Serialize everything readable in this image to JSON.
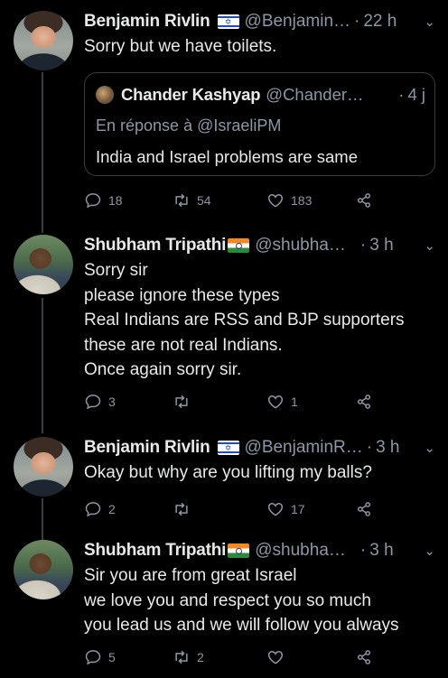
{
  "tweets": [
    {
      "author": "Benjamin Rivlin",
      "flag": "il",
      "handle": "@Benjamin…",
      "time": "22 h",
      "text": [
        "Sorry but we have toilets."
      ],
      "quote": {
        "author": "Chander Kashyap",
        "handle": "@Chander…",
        "time": "4 j",
        "reply_to": "En réponse à @IsraeliPM",
        "text": "India and Israel problems are same"
      },
      "replies": "18",
      "retweets": "54",
      "likes": "183"
    },
    {
      "author": "Shubham Tripathi",
      "flag": "in",
      "handle": "@shubha…",
      "time": "3 h",
      "text": [
        "Sorry sir",
        "please ignore these types",
        "Real Indians are RSS and BJP supporters",
        "these are not real Indians.",
        "Once again sorry sir."
      ],
      "replies": "3",
      "retweets": "",
      "likes": "1"
    },
    {
      "author": "Benjamin Rivlin",
      "flag": "il",
      "handle": "@BenjaminR…",
      "time": "3 h",
      "text": [
        "Okay but why are you lifting my balls?"
      ],
      "replies": "2",
      "retweets": "",
      "likes": "17"
    },
    {
      "author": "Shubham Tripathi",
      "flag": "in",
      "handle": "@shubha…",
      "time": "3 h",
      "text": [
        "Sir you are from great Israel",
        "we love you and respect you so much",
        "you lead us and we will follow you always"
      ],
      "replies": "5",
      "retweets": "2",
      "likes": ""
    }
  ],
  "separator": "·",
  "icons": {
    "reply": "reply-icon",
    "retweet": "retweet-icon",
    "like": "heart-icon",
    "share": "share-icon",
    "more": "chevron-down-icon"
  },
  "colors": {
    "background": "#000000",
    "text": "#e7e9ea",
    "muted": "#8b98a5",
    "border": "#3a3d40"
  }
}
